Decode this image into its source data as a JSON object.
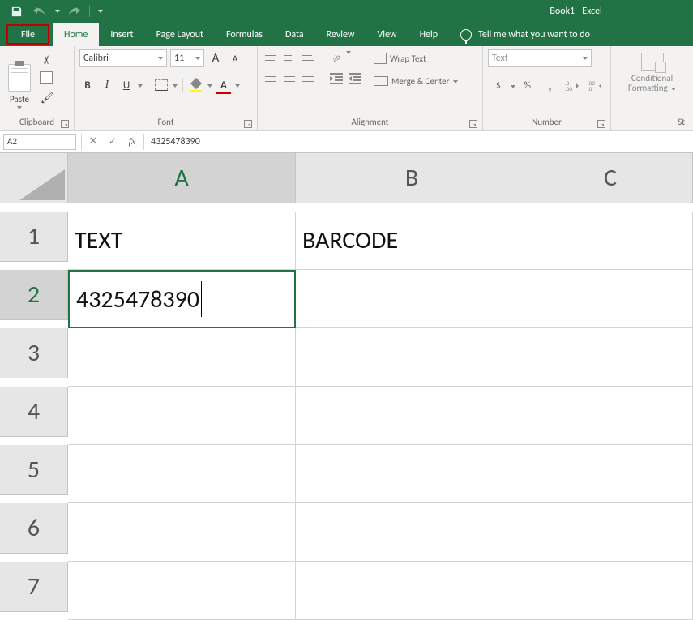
{
  "title": "Book1 - Excel",
  "qat": {
    "save": "save",
    "undo": "undo",
    "redo": "redo"
  },
  "tabs": {
    "file": "File",
    "home": "Home",
    "insert": "Insert",
    "pagelayout": "Page Layout",
    "formulas": "Formulas",
    "data": "Data",
    "review": "Review",
    "view": "View",
    "help": "Help",
    "tellme": "Tell me what you want to do"
  },
  "ribbon": {
    "clipboard": {
      "paste": "Paste",
      "label": "Clipboard"
    },
    "font": {
      "name": "Calibri",
      "size": "11",
      "grow": "A",
      "shrink": "A",
      "bold": "B",
      "italic": "I",
      "underline": "U",
      "color": "A",
      "label": "Font"
    },
    "alignment": {
      "wrap": "Wrap Text",
      "merge": "Merge & Center",
      "label": "Alignment"
    },
    "number": {
      "format": "Text",
      "currency": "$",
      "percent": "%",
      "comma": ",",
      "inc": ".0",
      "dec": ".00",
      "label": "Number"
    },
    "conditional": {
      "line1": "Conditional",
      "line2": "Formatting",
      "label": "St"
    }
  },
  "fxbar": {
    "name": "A2",
    "x": "✕",
    "check": "✓",
    "fx": "fx",
    "formula": "4325478390"
  },
  "columns": [
    "A",
    "B",
    "C"
  ],
  "rows": [
    "1",
    "2",
    "3",
    "4",
    "5",
    "6",
    "7"
  ],
  "cells": {
    "A1": "TEXT",
    "B1": "BARCODE",
    "A2": "4325478390"
  },
  "chart_data": {
    "type": "table",
    "columns": [
      "A",
      "B"
    ],
    "rows": [
      {
        "A": "TEXT",
        "B": "BARCODE"
      },
      {
        "A": "4325478390",
        "B": ""
      }
    ]
  }
}
